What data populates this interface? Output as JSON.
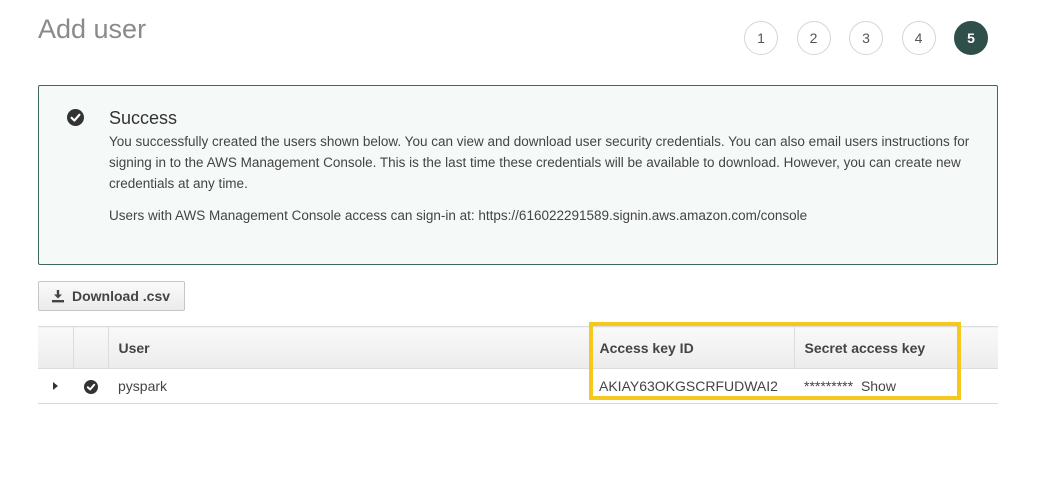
{
  "header": {
    "title": "Add user"
  },
  "steps": [
    {
      "label": "1",
      "active": false
    },
    {
      "label": "2",
      "active": false
    },
    {
      "label": "3",
      "active": false
    },
    {
      "label": "4",
      "active": false
    },
    {
      "label": "5",
      "active": true
    }
  ],
  "alert": {
    "icon": "check-circle-icon",
    "title": "Success",
    "message": "You successfully created the users shown below. You can view and download user security credentials. You can also email users instructions for signing in to the AWS Management Console. This is the last time these credentials will be available to download. However, you can create new credentials at any time.",
    "signin_text": "Users with AWS Management Console access can sign-in at: https://616022291589.signin.aws.amazon.com/console",
    "color": "#3c6a5c"
  },
  "toolbar": {
    "download_label": "Download .csv",
    "download_icon": "download-icon"
  },
  "table": {
    "columns": [
      "",
      "",
      "User",
      "Access key ID",
      "Secret access key"
    ],
    "rows": [
      {
        "expand_icon": "caret-right-icon",
        "status_icon": "check-circle-icon",
        "user": "pyspark",
        "access_key_id": "AKIAY63OKGSCRFUDWAI2",
        "secret_mask": "*********",
        "secret_show": "Show"
      }
    ]
  },
  "highlight_color": "#f4c81c"
}
